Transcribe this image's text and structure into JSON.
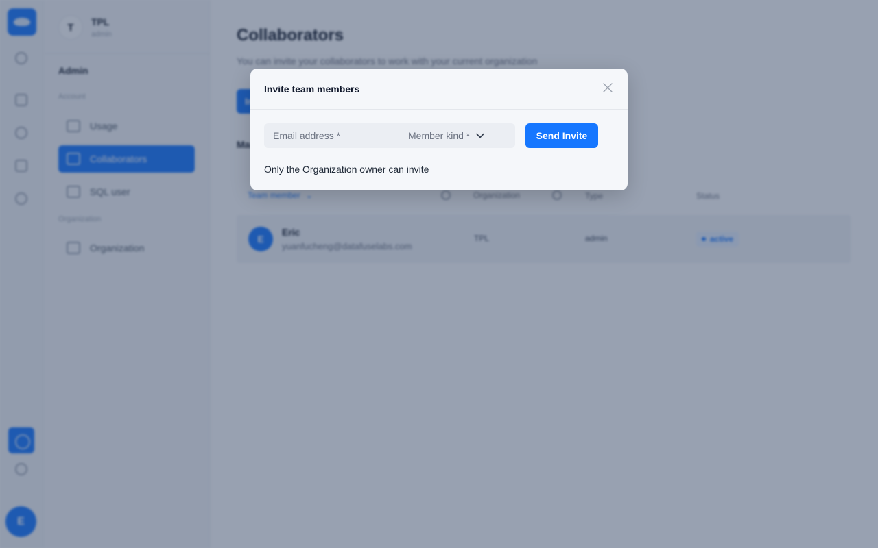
{
  "sidebar": {
    "org_initial": "T",
    "org_name": "TPL",
    "org_role": "admin",
    "title": "Admin",
    "group_account": "Account",
    "group_org": "Organization",
    "items": [
      {
        "label": "Usage",
        "icon": "usage-icon"
      },
      {
        "label": "Collaborators",
        "icon": "users-icon",
        "active": true
      },
      {
        "label": "SQL user",
        "icon": "sql-user-icon"
      },
      {
        "label": "Organization",
        "icon": "building-icon"
      }
    ]
  },
  "rail": {
    "user_initial": "E"
  },
  "main": {
    "title": "Collaborators",
    "subtitle": "You can invite your collaborators to work with your current organization",
    "invite_button": "Invite",
    "section_label": "Manage",
    "columns": [
      "Team member",
      "Organization",
      "Type",
      "Status"
    ],
    "rows": [
      {
        "initial": "E",
        "name": "Eric",
        "email": "yuanfucheng@datafuselabs.com",
        "organization": "TPL",
        "type": "admin",
        "status": "active"
      }
    ]
  },
  "modal": {
    "title": "Invite team members",
    "email_placeholder": "Email address *",
    "member_kind_placeholder": "Member kind *",
    "send_label": "Send Invite",
    "note": "Only the Organization owner can invite"
  },
  "colors": {
    "primary": "#1677ff",
    "overlay": "rgba(40,58,92,0.48)",
    "modal_bg": "#f5f7fa"
  }
}
